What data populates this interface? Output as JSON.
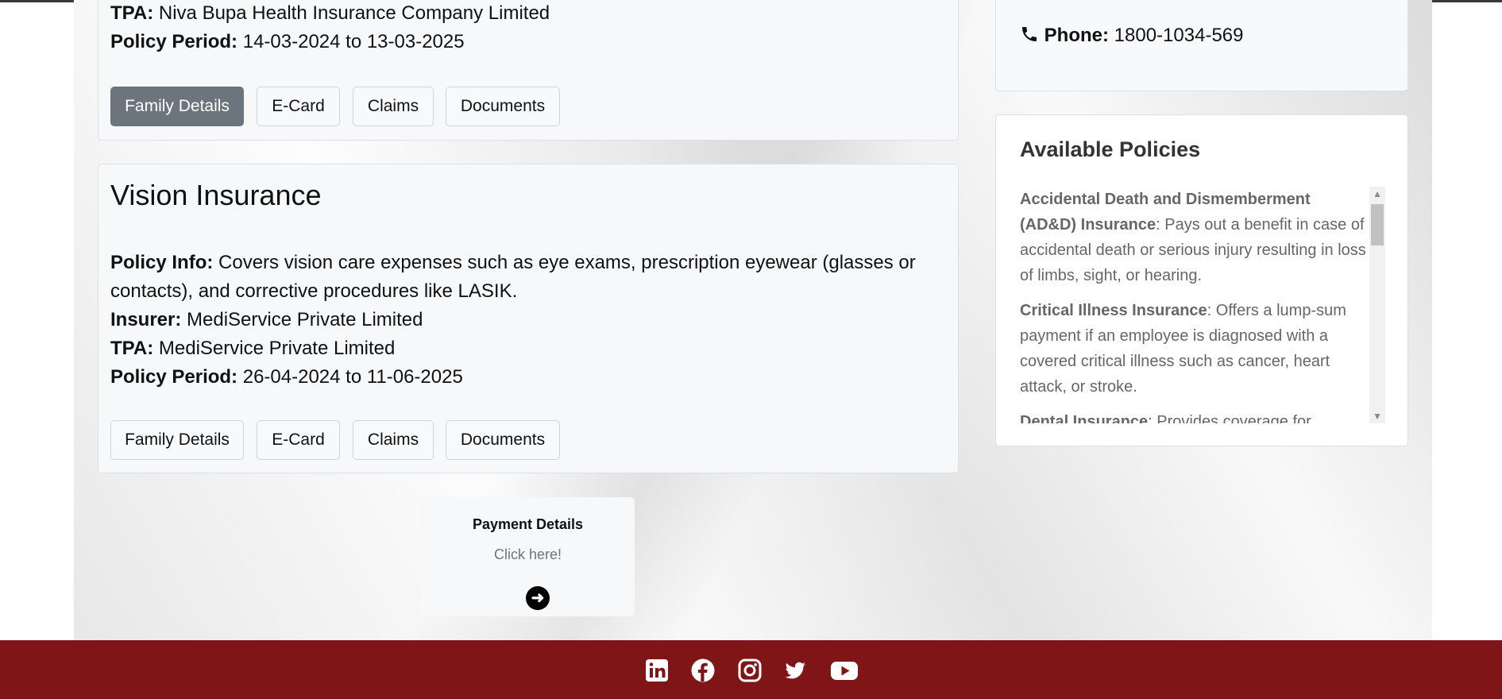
{
  "first_policy": {
    "tpa_label": "TPA:",
    "tpa_value": "Niva Bupa Health Insurance Company Limited",
    "period_label": "Policy Period:",
    "period_value": "14-03-2024 to 13-03-2025",
    "buttons": {
      "family": "Family Details",
      "ecard": "E-Card",
      "claims": "Claims",
      "documents": "Documents"
    }
  },
  "vision_policy": {
    "title": "Vision Insurance",
    "info_label": "Policy Info:",
    "info_value": "Covers vision care expenses such as eye exams, prescription eyewear (glasses or contacts), and corrective procedures like LASIK.",
    "insurer_label": "Insurer:",
    "insurer_value": "MediService Private Limited",
    "tpa_label": "TPA:",
    "tpa_value": "MediService Private Limited",
    "period_label": "Policy Period:",
    "period_value": "26-04-2024 to 11-06-2025",
    "buttons": {
      "family": "Family Details",
      "ecard": "E-Card",
      "claims": "Claims",
      "documents": "Documents"
    }
  },
  "contact": {
    "phone_label": "Phone:",
    "phone_value": "1800-1034-569",
    "icon": "phone-icon"
  },
  "available_policies": {
    "title": "Available Policies",
    "items": [
      {
        "name": "Accidental Death and Dismemberment (AD&D) Insurance",
        "desc": ": Pays out a benefit in case of accidental death or serious injury resulting in loss of limbs, sight, or hearing."
      },
      {
        "name": "Critical Illness Insurance",
        "desc": ": Offers a lump-sum payment if an employee is diagnosed with a covered critical illness such as cancer, heart attack, or stroke."
      },
      {
        "name": "Dental Insurance",
        "desc": ": Provides coverage for"
      }
    ]
  },
  "payment": {
    "title": "Payment Details",
    "link": "Click here!"
  },
  "footer": {
    "background": "#801517",
    "icons": [
      "linkedin-icon",
      "facebook-icon",
      "instagram-icon",
      "twitter-icon",
      "youtube-icon"
    ]
  }
}
